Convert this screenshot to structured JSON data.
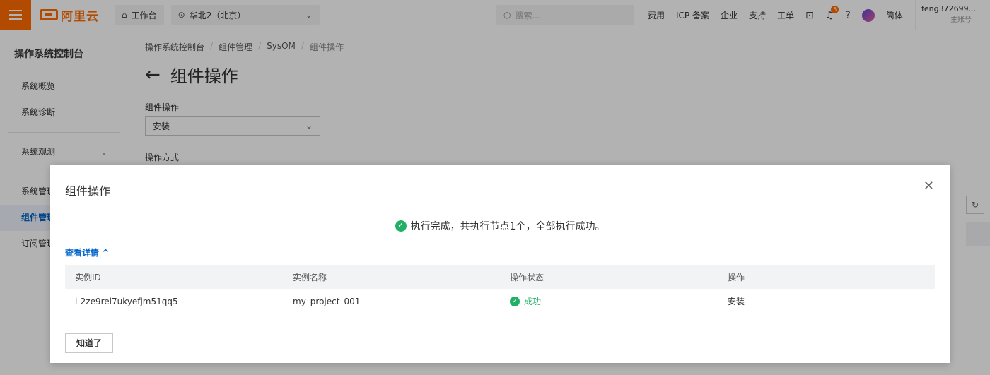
{
  "topbar": {
    "logo_text": "阿里云",
    "workbench": "工作台",
    "region": "华北2（北京）",
    "search_placeholder": "搜索...",
    "links": [
      "费用",
      "ICP 备案",
      "企业",
      "支持",
      "工单"
    ],
    "notification_count": "5",
    "language": "简体",
    "account_name": "feng372699...",
    "account_type": "主账号"
  },
  "sidebar": {
    "title": "操作系统控制台",
    "items": [
      "系统概览",
      "系统诊断",
      "系统观测",
      "系统管理",
      "组件管理",
      "订阅管理"
    ]
  },
  "main": {
    "breadcrumb": [
      "操作系统控制台",
      "组件管理",
      "SysOM",
      "组件操作"
    ],
    "title": "组件操作",
    "field_operation_label": "组件操作",
    "field_operation_value": "安装",
    "field_method_label": "操作方式"
  },
  "modal": {
    "title": "组件操作",
    "result_text": "执行完成，共执行节点1个，全部执行成功。",
    "details_link": "查看详情",
    "columns": [
      "实例ID",
      "实例名称",
      "操作状态",
      "操作"
    ],
    "rows": [
      {
        "id": "i-2ze9rel7ukyefjm51qq5",
        "name": "my_project_001",
        "status": "成功",
        "action": "安装"
      }
    ],
    "confirm_button": "知道了"
  },
  "colors": {
    "brand": "#ff6a00",
    "link": "#0064c8",
    "success": "#23b066"
  }
}
